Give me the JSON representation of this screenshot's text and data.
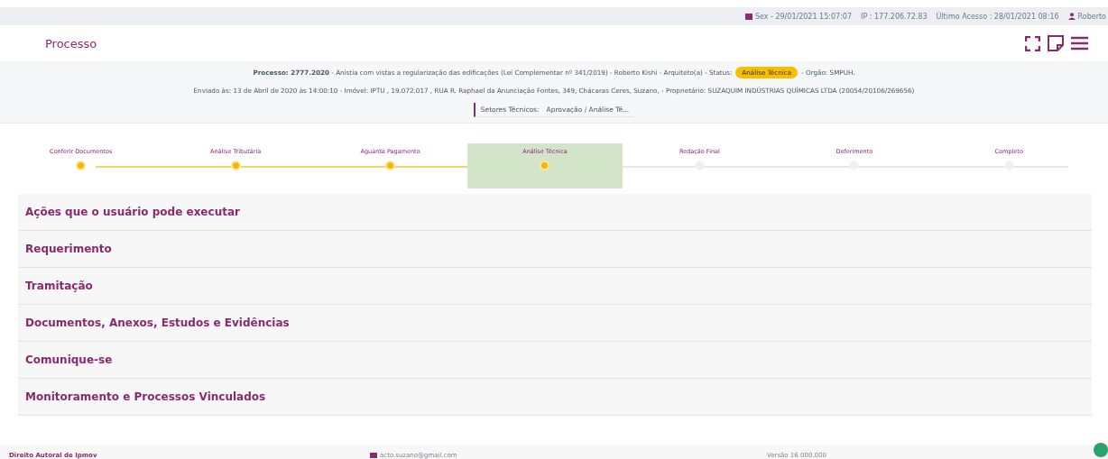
{
  "top_bar": {
    "date": "Sex - 29/01/2021 15:07:07",
    "ip": "IP : 177.206.72.83",
    "last_access": "Último Acesso : 28/01/2021 08:16",
    "user": "Roberto"
  },
  "header": {
    "title": "Processo"
  },
  "info": {
    "summary": "**Processo: 2777.2020** - Anistia com vistas a regularização das edificações (Lei Complementar nº 341/2019) - Roberto Kishi - Arquiteto(a) - Status:",
    "status": "Análise Técnica",
    "orgao": "- Orgão: SMPUH.",
    "details": "Enviado às: 13 de Abril de 2020 às 14:00:10 - Imóvel: IPTU , 19.072.017 , RUA R. Raphael da Anunciação Fontes, 349, Chácaras Ceres, Suzano, - Proprietário: SUZAQUIM INDÚSTRIAS QUÍMICAS LTDA (20054/20106/269656)",
    "sectors_label": "Setores Técnicos:",
    "sectors_value": "Aprovação / Análise Té..."
  },
  "steps": [
    {
      "label": "Conferir Documentos",
      "done": true,
      "selected": false
    },
    {
      "label": "Análise Tributária",
      "done": true,
      "selected": false
    },
    {
      "label": "Aguarda Pagamento",
      "done": true,
      "selected": false
    },
    {
      "label": "Análise Técnica",
      "done": true,
      "selected": true
    },
    {
      "label": "Redação Final",
      "done": false,
      "selected": false
    },
    {
      "label": "Deferimento",
      "done": false,
      "selected": false
    },
    {
      "label": "Completo",
      "done": false,
      "selected": false
    }
  ],
  "sections": [
    {
      "title": "Ações que o usuário pode executar",
      "expanded": false
    },
    {
      "title": "Requerimento",
      "expanded": false
    },
    {
      "title": "Tramitação",
      "expanded": false
    },
    {
      "title": "Documentos, Anexos, Estudos e Evidências",
      "expanded": false
    },
    {
      "title": "Comunique-se",
      "expanded": false
    },
    {
      "title": "Monitoramento e Processos Vinculados",
      "expanded": false
    }
  ],
  "footer": {
    "copyright": "Direito Autoral de Ipmov",
    "email": "acto.suzano@gmail.com",
    "version": "Versão 16.000.000"
  }
}
